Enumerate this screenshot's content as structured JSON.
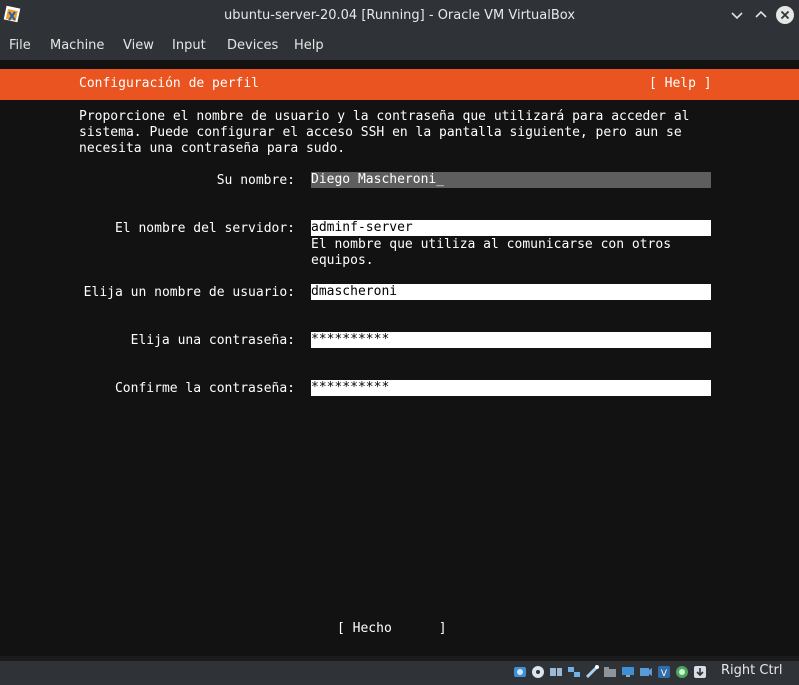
{
  "window": {
    "title": "ubuntu-server-20.04 [Running] - Oracle VM VirtualBox"
  },
  "menu": {
    "items": [
      "File",
      "Machine",
      "View",
      "Input",
      "Devices",
      "Help"
    ]
  },
  "screen": {
    "header_title": "Configuración de perfil",
    "help_label": "[ Help ]",
    "intro_lines": [
      "Proporcione el nombre de usuario y la contraseña que utilizará para acceder al",
      "sistema. Puede configurar el acceso SSH en la pantalla siguiente, pero aun se",
      "necesita una contraseña para sudo."
    ],
    "fields": [
      {
        "label": "Su nombre:",
        "value": "Diego Mascheroni_"
      },
      {
        "label": "El nombre del servidor:",
        "value": "adminf-server",
        "help_lines": [
          "El nombre que utiliza al comunicarse con otros",
          "equipos."
        ]
      },
      {
        "label": "Elija un nombre de usuario:",
        "value": "dmascheroni"
      },
      {
        "label": "Elija una contraseña:",
        "value": "**********"
      },
      {
        "label": "Confirme la contraseña:",
        "value": "**********"
      }
    ],
    "done_button": "[ Hecho      ]"
  },
  "statusbar": {
    "host_key": "Right Ctrl",
    "icons": [
      "hard-disk-icon",
      "optical-disk-icon",
      "audio-icon",
      "network-icon",
      "usb-icon",
      "shared-folders-icon",
      "display-icon",
      "recording-icon",
      "virtualization-icon",
      "mouse-integration-icon",
      "keyboard-capture-icon"
    ]
  },
  "colors": {
    "accent": "#e95420",
    "screen_bg": "#121212",
    "chrome_bg": "#2f3237"
  }
}
